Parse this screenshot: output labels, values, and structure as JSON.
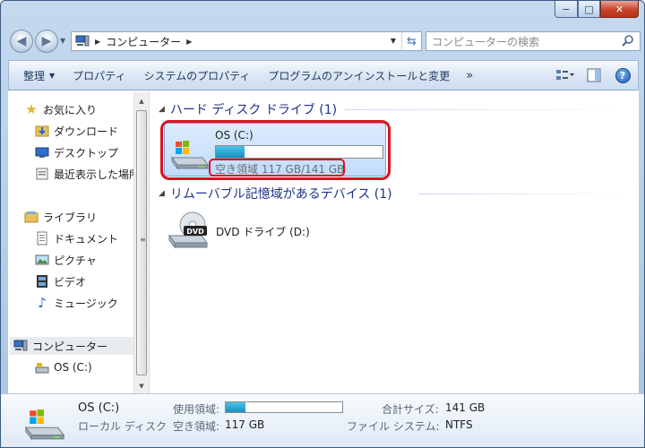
{
  "window": {
    "minimize_glyph": "−",
    "maximize_glyph": "□",
    "close_glyph": "✕"
  },
  "address_bar": {
    "location": "コンピューター",
    "search_placeholder": "コンピューターの検索"
  },
  "toolbar": {
    "organize": "整理",
    "properties": "プロパティ",
    "system_properties": "システムのプロパティ",
    "uninstall": "プログラムのアンインストールと変更",
    "more": "»"
  },
  "nav_pane": {
    "favorites": "お気に入り",
    "downloads": "ダウンロード",
    "desktop": "デスクトップ",
    "recent": "最近表示した場所",
    "libraries": "ライブラリ",
    "documents": "ドキュメント",
    "pictures": "ピクチャ",
    "videos": "ビデオ",
    "music": "ミュージック",
    "computer": "コンピューター",
    "os_drive": "OS (C:)"
  },
  "content": {
    "hdd_group": "ハード ディスク ドライブ (1)",
    "removable_group": "リムーバブル記憶域があるデバイス (1)",
    "drive_c": {
      "name": "OS (C:)",
      "free_text": "空き領域 117 GB/141 GB",
      "used_fraction": 0.17
    },
    "drive_d": {
      "name": "DVD ドライブ (D:)",
      "badge": "DVD"
    }
  },
  "details": {
    "name": "OS (C:)",
    "type": "ローカル ディスク",
    "used_label": "使用領域:",
    "free_label": "空き領域:",
    "free_value": "117 GB",
    "total_label": "合計サイズ:",
    "total_value": "141 GB",
    "fs_label": "ファイル システム:",
    "fs_value": "NTFS",
    "used_fraction": 0.17
  },
  "colors": {
    "highlight_red": "#d8141e",
    "group_header": "#1e3287",
    "bar_fill": "#1a8fbf"
  }
}
